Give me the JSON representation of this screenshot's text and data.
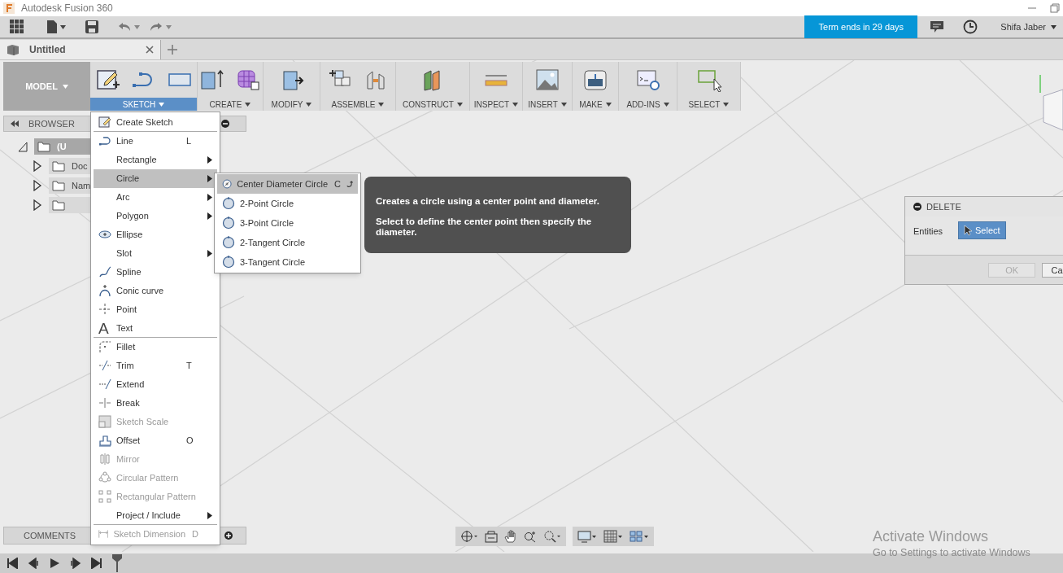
{
  "window": {
    "title": "Autodesk Fusion 360"
  },
  "toolbar": {
    "trial": "Term ends in 29 days",
    "user": "Shifa Jaber"
  },
  "tabs": [
    {
      "label": "Untitled",
      "selected": true
    }
  ],
  "ribbon": {
    "workspace": "MODEL",
    "groups": [
      {
        "label": "SKETCH",
        "selected": true
      },
      {
        "label": "CREATE",
        "selected": false
      },
      {
        "label": "MODIFY",
        "selected": false
      },
      {
        "label": "ASSEMBLE",
        "selected": false
      },
      {
        "label": "CONSTRUCT",
        "selected": false
      },
      {
        "label": "INSPECT",
        "selected": false
      },
      {
        "label": "INSERT",
        "selected": false
      },
      {
        "label": "MAKE",
        "selected": false
      },
      {
        "label": "ADD-INS",
        "selected": false
      },
      {
        "label": "SELECT",
        "selected": false
      }
    ]
  },
  "browser": {
    "title": "BROWSER",
    "items": [
      {
        "label": "(U",
        "expanded": true,
        "children": [
          {
            "label": "Doc",
            "expanded": false
          },
          {
            "label": "Nam",
            "expanded": false
          },
          {
            "expanded": false
          }
        ]
      }
    ]
  },
  "sketch_menu": [
    {
      "label": "Create Sketch",
      "submenu": false,
      "disabled": false,
      "selected": false,
      "divider_after": true
    },
    {
      "label": "Line",
      "shortcut": "L",
      "submenu": false,
      "disabled": false,
      "selected": false,
      "divider_after": false
    },
    {
      "label": "Rectangle",
      "submenu": true,
      "disabled": false,
      "selected": false,
      "divider_after": false
    },
    {
      "label": "Circle",
      "submenu": true,
      "disabled": false,
      "selected": true,
      "divider_after": false
    },
    {
      "label": "Arc",
      "submenu": true,
      "disabled": false,
      "selected": false,
      "divider_after": false
    },
    {
      "label": "Polygon",
      "submenu": true,
      "disabled": false,
      "selected": false,
      "divider_after": false
    },
    {
      "label": "Ellipse",
      "submenu": false,
      "disabled": false,
      "selected": false,
      "divider_after": false
    },
    {
      "label": "Slot",
      "submenu": true,
      "disabled": false,
      "selected": false,
      "divider_after": false
    },
    {
      "label": "Spline",
      "submenu": false,
      "disabled": false,
      "selected": false,
      "divider_after": false
    },
    {
      "label": "Conic curve",
      "submenu": false,
      "disabled": false,
      "selected": false,
      "divider_after": false
    },
    {
      "label": "Point",
      "submenu": false,
      "disabled": false,
      "selected": false,
      "divider_after": false
    },
    {
      "label": "Text",
      "icon_glyph": "A",
      "submenu": false,
      "disabled": false,
      "selected": false,
      "divider_after": true
    },
    {
      "label": "Fillet",
      "submenu": false,
      "disabled": false,
      "selected": false,
      "divider_after": false
    },
    {
      "label": "Trim",
      "shortcut": "T",
      "submenu": false,
      "disabled": false,
      "selected": false,
      "divider_after": false
    },
    {
      "label": "Extend",
      "submenu": false,
      "disabled": false,
      "selected": false,
      "divider_after": false
    },
    {
      "label": "Break",
      "submenu": false,
      "disabled": false,
      "selected": false,
      "divider_after": false
    },
    {
      "label": "Sketch Scale",
      "submenu": false,
      "disabled": true,
      "selected": false,
      "divider_after": false
    },
    {
      "label": "Offset",
      "shortcut": "O",
      "submenu": false,
      "disabled": false,
      "selected": false,
      "divider_after": false
    },
    {
      "label": "Mirror",
      "submenu": false,
      "disabled": true,
      "selected": false,
      "divider_after": false
    },
    {
      "label": "Circular Pattern",
      "submenu": false,
      "disabled": true,
      "selected": false,
      "divider_after": false
    },
    {
      "label": "Rectangular Pattern",
      "submenu": false,
      "disabled": true,
      "selected": false,
      "divider_after": false
    },
    {
      "label": "Project / Include",
      "submenu": true,
      "disabled": false,
      "selected": false,
      "divider_after": true
    },
    {
      "label": "Sketch Dimension",
      "shortcut": "D",
      "submenu": false,
      "disabled": true,
      "selected": false,
      "divider_after": false
    }
  ],
  "circle_submenu": [
    {
      "label": "Center Diameter Circle",
      "shortcut": "C",
      "selected": true
    },
    {
      "label": "2-Point Circle",
      "selected": false
    },
    {
      "label": "3-Point Circle",
      "selected": false
    },
    {
      "label": "2-Tangent Circle",
      "selected": false
    },
    {
      "label": "3-Tangent Circle",
      "selected": false
    }
  ],
  "tooltip": [
    "Creates a circle using a center point and diameter.",
    "Select to define the center point then specify the diameter."
  ],
  "delete_panel": {
    "title": "DELETE",
    "field_label": "Entities",
    "select_button": "Select",
    "ok": "OK",
    "ok_disabled": true,
    "cancel": "Ca"
  },
  "comments": {
    "title": "COMMENTS"
  },
  "activation": {
    "title": "Activate Windows",
    "subtitle": "Go to Settings to activate Windows"
  }
}
